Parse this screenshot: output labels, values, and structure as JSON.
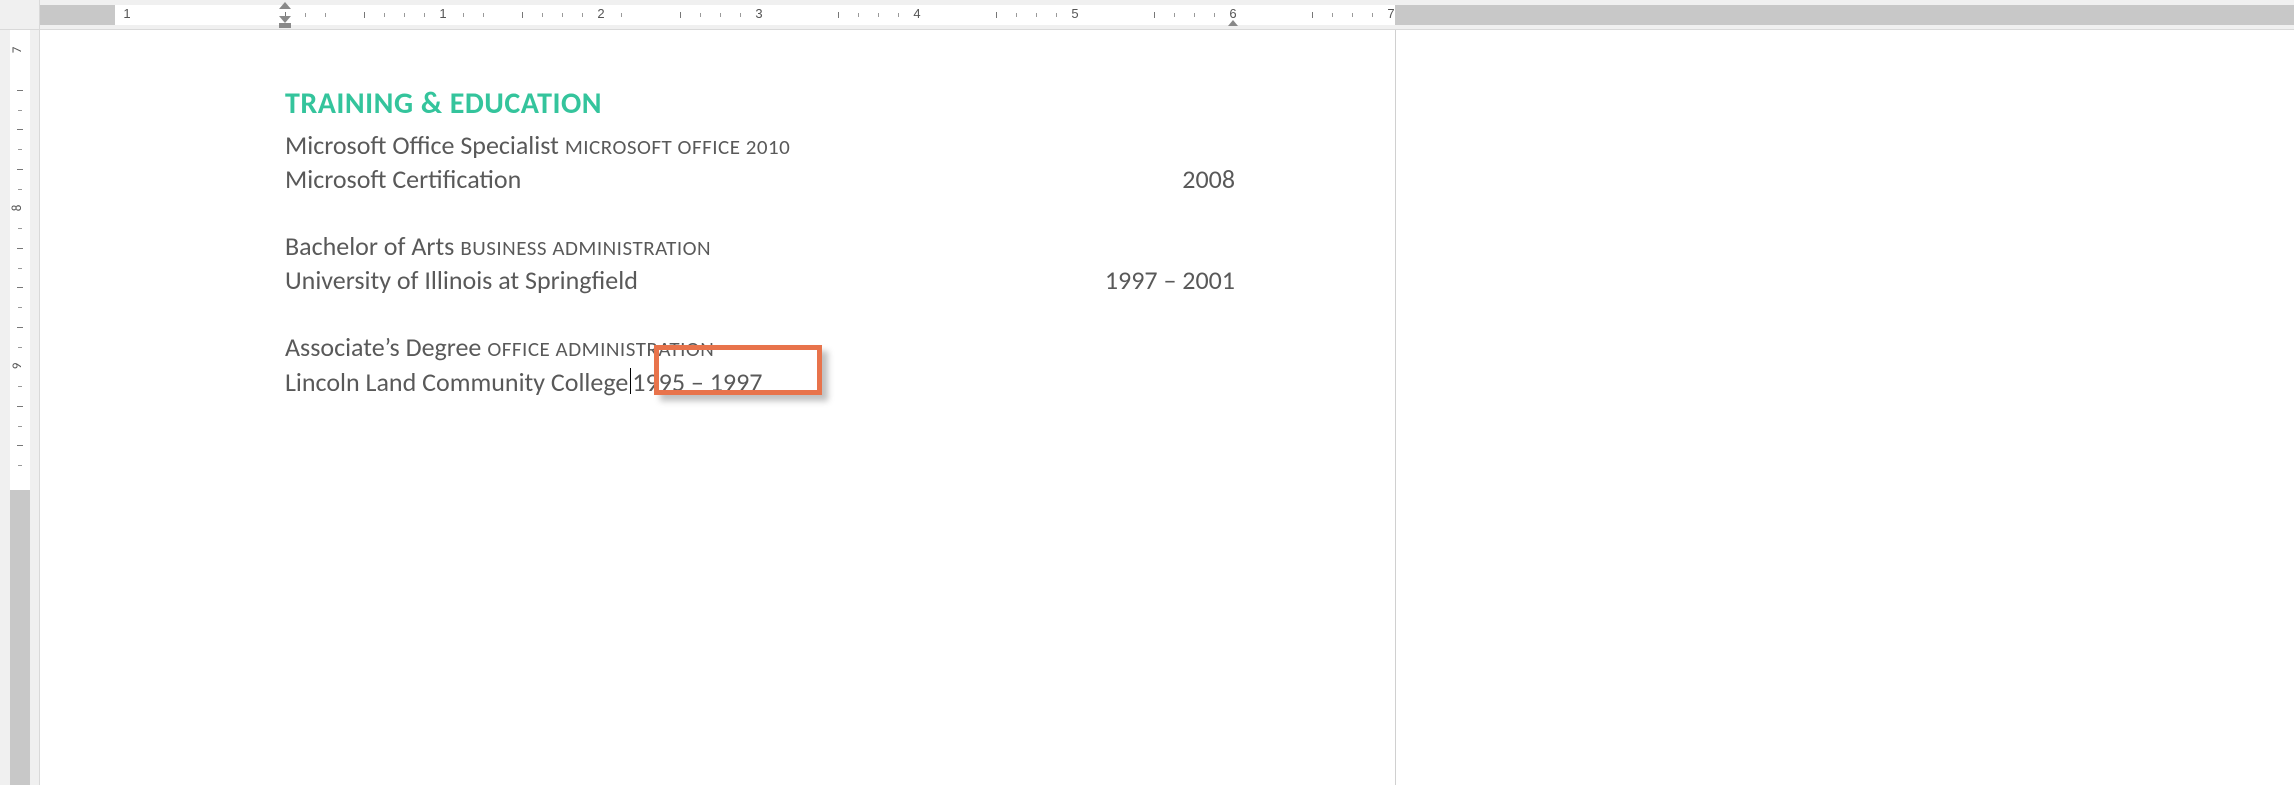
{
  "ruler": {
    "h_numbers": [
      "1",
      "2",
      "3",
      "4",
      "5",
      "6",
      "7"
    ],
    "v_numbers": [
      "7",
      "8",
      "9"
    ]
  },
  "document": {
    "heading": "TRAINING & EDUCATION",
    "entries": [
      {
        "title": "Microsoft Office Specialist",
        "subtitle": "MICROSOFT OFFICE 2010",
        "place": "Microsoft Certification",
        "date": "2008",
        "date_inline": false
      },
      {
        "title": "Bachelor of Arts",
        "subtitle": "BUSINESS ADMINISTRATION",
        "place": "University of Illinois at Springfield",
        "date": "1997 – 2001",
        "date_inline": false
      },
      {
        "title": "Associate’s Degree",
        "subtitle": "OFFICE ADMINISTRATION",
        "place": "Lincoln Land Community College",
        "date": "1995 – 1997",
        "date_inline": true,
        "highlighted": true
      }
    ]
  },
  "colors": {
    "heading": "#34c49c",
    "text": "#595959",
    "highlight": "#e8734b"
  }
}
